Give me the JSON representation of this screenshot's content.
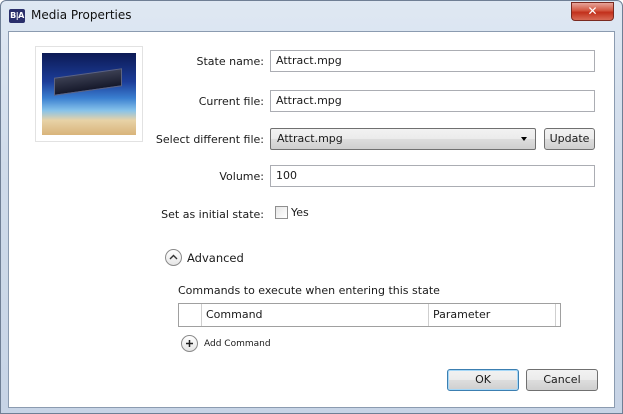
{
  "window": {
    "title": "Media Properties",
    "icon_text": "B|A",
    "close_glyph": "✕"
  },
  "form": {
    "state_name_label": "State name:",
    "state_name_value": "Attract.mpg",
    "current_file_label": "Current file:",
    "current_file_value": "Attract.mpg",
    "select_file_label": "Select different file:",
    "select_file_value": "Attract.mpg",
    "update_label": "Update",
    "volume_label": "Volume:",
    "volume_value": "100",
    "initial_state_label": "Set as initial state:",
    "initial_state_option": "Yes",
    "initial_state_checked": false
  },
  "advanced": {
    "toggle_label": "Advanced",
    "commands_caption": "Commands to execute when entering this state",
    "columns": [
      "Command",
      "Parameter"
    ],
    "rows": [],
    "add_command_label": "Add Command"
  },
  "footer": {
    "ok_label": "OK",
    "cancel_label": "Cancel"
  },
  "icons": {
    "expand": "chevron-up-icon",
    "add": "plus-icon",
    "dropdown": "chevron-down-icon"
  },
  "colors": {
    "close_button": "#c2301b",
    "default_button_border": "#3c7fb1"
  }
}
